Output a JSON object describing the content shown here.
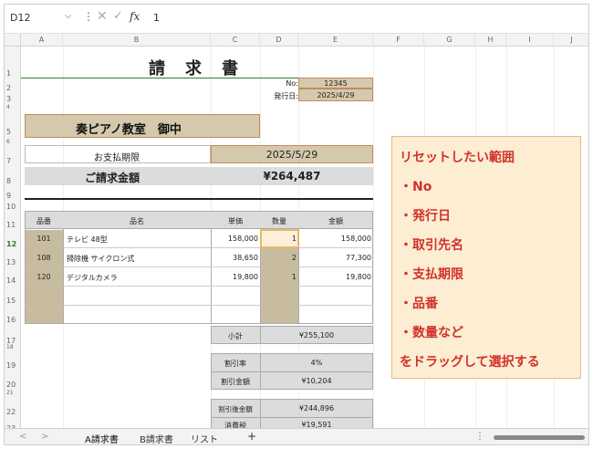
{
  "formula_bar": {
    "cell_ref": "D12",
    "fx_label": "fx",
    "value": "1"
  },
  "columns": [
    "A",
    "B",
    "C",
    "D",
    "E",
    "F",
    "G",
    "H",
    "I",
    "J"
  ],
  "rows": [
    "1",
    "2",
    "3",
    "4",
    "5",
    "6",
    "7",
    "8",
    "9",
    "10",
    "11",
    "12",
    "13",
    "14",
    "15",
    "16",
    "17",
    "18",
    "19",
    "20",
    "21",
    "22",
    "23"
  ],
  "invoice": {
    "title": "請　求　書",
    "no_label": "No:",
    "no_value": "12345",
    "issue_label": "発行日:",
    "issue_value": "2025/4/29",
    "customer": "奏ピアノ教室　御中",
    "due_label": "お支払期限",
    "due_value": "2025/5/29",
    "amount_label": "ご請求金額",
    "amount_value": "¥264,487",
    "headers": [
      "品番",
      "品名",
      "単価",
      "数量",
      "金額"
    ],
    "items": [
      {
        "code": "101",
        "name": "テレビ 48型",
        "price": "158,000",
        "qty": "1",
        "total": "158,000"
      },
      {
        "code": "108",
        "name": "掃除機 サイクロン式",
        "price": "38,650",
        "qty": "2",
        "total": "77,300"
      },
      {
        "code": "120",
        "name": "デジタルカメラ",
        "price": "19,800",
        "qty": "1",
        "total": "19,800"
      }
    ],
    "subtotal_label": "小計",
    "subtotal_value": "¥255,100",
    "discount_rate_label": "割引率",
    "discount_rate_value": "4%",
    "discount_amount_label": "割引金額",
    "discount_amount_value": "¥10,204",
    "after_discount_label": "割引後金額",
    "after_discount_value": "¥244,896",
    "tax_label": "消費税",
    "tax_value": "¥19,591"
  },
  "callout": {
    "lines": [
      "リセットしたい範囲",
      "・No",
      "・発行日",
      "・取引先名",
      "・支払期限",
      "・品番",
      "・数量など",
      "をドラッグして選択する"
    ]
  },
  "tabs": {
    "prev": "<",
    "next": ">",
    "sheets": [
      "A請求書",
      "B請求書",
      "リスト"
    ],
    "add": "+"
  },
  "colors": {
    "accent_green": "#2e7d32",
    "highlight_tan": "#c8bca0",
    "callout_bg": "#fdeed3",
    "callout_text": "#d0322a"
  }
}
